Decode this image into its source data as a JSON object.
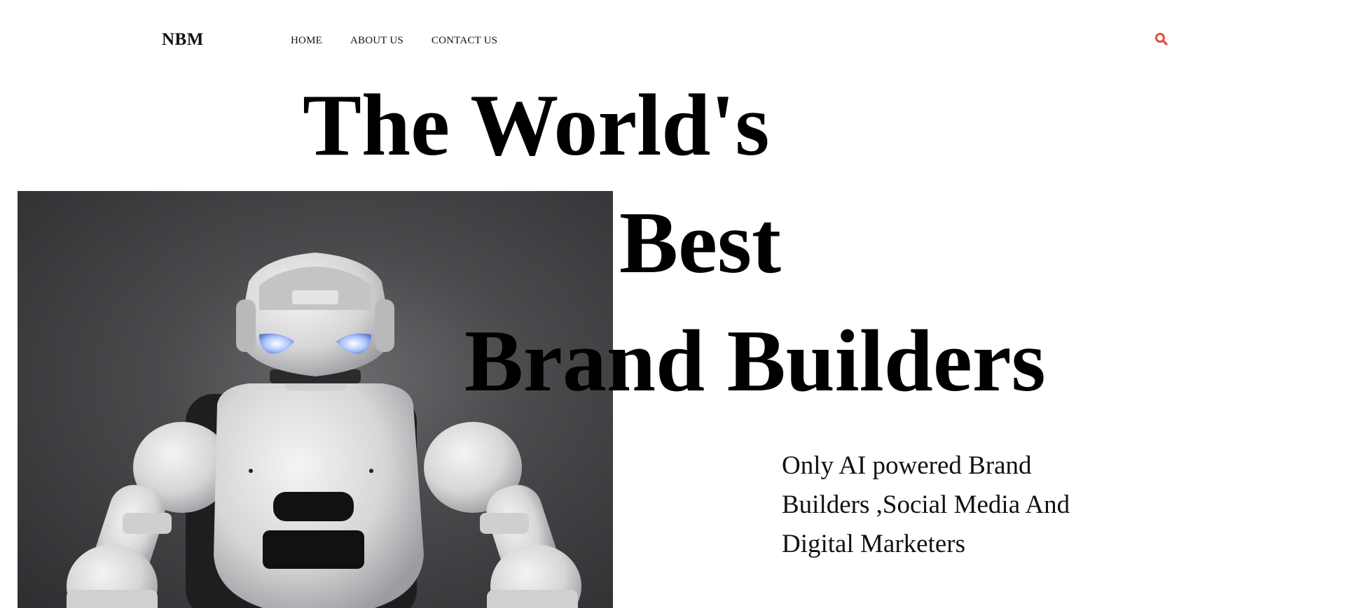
{
  "header": {
    "brand": "NBM",
    "nav": [
      {
        "label": "HOME"
      },
      {
        "label": "ABOUT US"
      },
      {
        "label": "CONTACT US"
      }
    ],
    "search_icon": "search-icon",
    "accent_color": "#e74c3c"
  },
  "hero": {
    "headline": [
      "The World's",
      "Best",
      "Brand Builders"
    ],
    "tagline": "Only AI powered Brand Builders ,Social Media And Digital Marketers",
    "image": "robot-photo"
  }
}
